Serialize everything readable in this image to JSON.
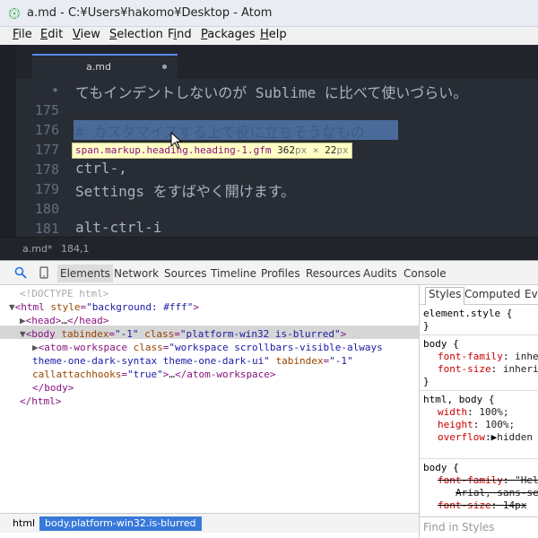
{
  "window": {
    "title": "a.md - C:¥Users¥hakomo¥Desktop - Atom"
  },
  "menu": [
    {
      "label": "File",
      "key": "F"
    },
    {
      "label": "Edit",
      "key": "E"
    },
    {
      "label": "View",
      "key": "V"
    },
    {
      "label": "Selection",
      "key": "S"
    },
    {
      "label": "Find",
      "key": "i"
    },
    {
      "label": "Packages",
      "key": "P"
    },
    {
      "label": "Help",
      "key": "H"
    }
  ],
  "editor": {
    "tab_label": "a.md",
    "line_numbers": [
      "•",
      "175",
      "176",
      "177",
      "178",
      "179",
      "180",
      "181"
    ],
    "lines": [
      "てもインデントしないのが Sublime に比べて使いづらい。",
      "",
      "# カスタマイズする上で役に立ちそうなもの",
      "",
      "ctrl-,",
      "Settings をすばやく開けます。",
      "",
      "alt-ctrl-i"
    ],
    "tooltip": {
      "selector": "span.markup.heading.heading-1.gfm",
      "width": "362",
      "height": "22",
      "unit": "px",
      "times": "×"
    },
    "status_file": "a.md*",
    "status_pos": "184,1"
  },
  "devtools": {
    "tabs": [
      "Elements",
      "Network",
      "Sources",
      "Timeline",
      "Profiles",
      "Resources",
      "Audits",
      "Console"
    ],
    "dom": {
      "doctype": "<!DOCTYPE html>",
      "html_open_tag": "html",
      "html_attr": "style",
      "html_val": "\"background: #fff\"",
      "head": "head",
      "head_end": "</head>",
      "body_tag": "body",
      "body_attr1": "tabindex",
      "body_val1": "\"-1\"",
      "body_attr2": "class",
      "body_val2": "\"platform-win32 is-blurred\"",
      "ws_tag": "atom-workspace",
      "ws_attr1": "class",
      "ws_val1": "\"workspace scrollbars-visible-always",
      "ws_val1b": "theme-one-dark-syntax theme-one-dark-ui\"",
      "ws_attr2": "tabindex",
      "ws_val2": "\"-1\"",
      "ws_attr3": "callattachhooks",
      "ws_val3": "\"true\"",
      "ws_end": "</atom-workspace>",
      "body_close": "</body>",
      "html_close": "</html>"
    },
    "styles_tabs": [
      "Styles",
      "Computed",
      "Eve"
    ],
    "styles": {
      "element_style": "element.style {",
      "close": "}",
      "rule1_selector": "body {",
      "rule1_p1": "font-family",
      "rule1_v1": "inhe",
      "rule1_p2": "font-size",
      "rule1_v2": "inheri",
      "rule2_selector": "html, body {",
      "rule2_p1": "width",
      "rule2_v1": "100%;",
      "rule2_p2": "height",
      "rule2_v2": "100%;",
      "rule2_p3": "overflow",
      "rule2_v3": "hidden",
      "rule3_selector": "body {",
      "rule3_p1": "font-family",
      "rule3_v1": "\"Hel",
      "rule3_v1b": "Arial, sans-se",
      "rule3_p2": "font-size",
      "rule3_v2": "14px",
      "find_placeholder": "Find in Styles"
    },
    "breadcrumbs": [
      "html",
      "body.platform-win32.is-blurred"
    ]
  }
}
